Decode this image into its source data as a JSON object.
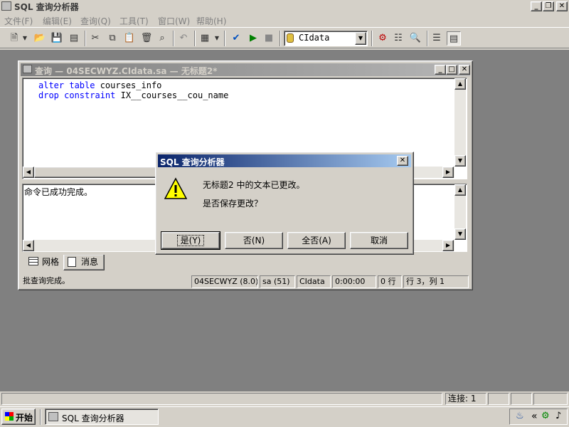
{
  "app": {
    "title": "SQL 查询分析器"
  },
  "menubar": {
    "items": [
      "文件(F)",
      "编辑(E)",
      "查询(Q)",
      "工具(T)",
      "窗口(W)",
      "帮助(H)"
    ]
  },
  "toolbar": {
    "database_selected": "CIdata"
  },
  "query_window": {
    "title": "查询 — 04SECWYZ.CIdata.sa — 无标题2*",
    "editor_lines": [
      {
        "kw": "alter table",
        "rest": " courses_info"
      },
      {
        "kw": "drop constraint",
        "rest": " IX__courses__cou_name"
      }
    ],
    "results_text": "命令已成功完成。",
    "tabs": [
      "网格",
      "消息"
    ],
    "status": {
      "message": "批查询完成。",
      "server": "04SECWYZ (8.0)",
      "user": "sa (51)",
      "database": "CIdata",
      "elapsed": "0:00:00",
      "rows": "0 行",
      "position": "行 3，列 1"
    }
  },
  "dialog": {
    "title": "SQL 查询分析器",
    "message_line1": "无标题2 中的文本已更改。",
    "message_line2": "是否保存更改？",
    "buttons": {
      "yes": "是(Y)",
      "no": "否(N)",
      "no_to_all": "全否(A)",
      "cancel": "取消"
    }
  },
  "app_status": {
    "connections": "连接: 1"
  },
  "taskbar": {
    "start_label": "开始",
    "task_label": "SQL 查询分析器"
  },
  "colors": {
    "dialog_title": "#0a246a",
    "inactive_title": "#808080",
    "keyword": "#0000ff",
    "desktop_mdi": "#808080"
  }
}
